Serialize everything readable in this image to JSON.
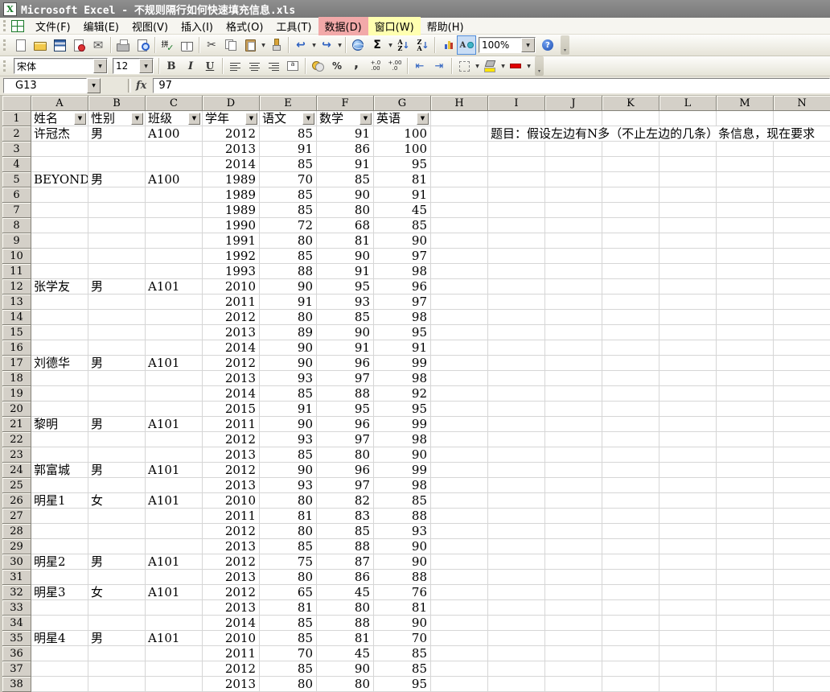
{
  "window_title": "Microsoft Excel - 不规则隔行如何快速填充信息.xls",
  "menu_bar": {
    "items": [
      {
        "name": "menu-item-file",
        "label": "文件(F)"
      },
      {
        "name": "menu-item-edit",
        "label": "编辑(E)"
      },
      {
        "name": "menu-item-view",
        "label": "视图(V)"
      },
      {
        "name": "menu-item-insert",
        "label": "插入(I)"
      },
      {
        "name": "menu-item-format",
        "label": "格式(O)"
      },
      {
        "name": "menu-item-tools",
        "label": "工具(T)"
      },
      {
        "name": "menu-item-data",
        "label": "数据(D)",
        "highlight": "#f2a9a9"
      },
      {
        "name": "menu-item-window",
        "label": "窗口(W)",
        "highlight": "#ffffb0"
      },
      {
        "name": "menu-item-help",
        "label": "帮助(H)"
      }
    ]
  },
  "standard_toolbar": {
    "zoom_value": "100%",
    "icons": [
      {
        "name": "new-icon"
      },
      {
        "name": "open-icon"
      },
      {
        "name": "save-icon"
      },
      {
        "name": "permission-icon"
      },
      {
        "name": "mail-icon",
        "glyph": "✉"
      },
      {
        "name": "separator"
      },
      {
        "name": "print-icon"
      },
      {
        "name": "print-preview-icon"
      },
      {
        "name": "separator"
      },
      {
        "name": "spelling-icon"
      },
      {
        "name": "research-icon"
      },
      {
        "name": "separator"
      },
      {
        "name": "cut-icon",
        "glyph": "✂"
      },
      {
        "name": "copy-icon"
      },
      {
        "name": "paste-icon",
        "dd": true
      },
      {
        "name": "format-painter-icon"
      },
      {
        "name": "separator"
      },
      {
        "name": "undo-icon",
        "glyph": "↩",
        "dd": true
      },
      {
        "name": "redo-icon",
        "glyph": "↪",
        "dd": true
      },
      {
        "name": "separator"
      },
      {
        "name": "hyperlink-icon"
      },
      {
        "name": "autosum-icon",
        "glyph": "Σ",
        "dd": true
      },
      {
        "name": "sort-asc-icon",
        "glyph": "↓"
      },
      {
        "name": "sort-desc-icon",
        "glyph": "↓"
      },
      {
        "name": "separator"
      },
      {
        "name": "chart-wizard-icon"
      },
      {
        "name": "drawing-icon",
        "active": true
      },
      {
        "name": "zoom-combo"
      },
      {
        "name": "help-icon"
      }
    ]
  },
  "formatting_toolbar": {
    "font_name": "宋体",
    "font_size": "12",
    "icons": [
      {
        "name": "font-combo"
      },
      {
        "name": "size-combo"
      },
      {
        "name": "separator"
      },
      {
        "name": "bold-icon",
        "glyph": "B"
      },
      {
        "name": "italic-icon",
        "glyph": "I"
      },
      {
        "name": "underline-icon",
        "glyph": "U"
      },
      {
        "name": "separator"
      },
      {
        "name": "align-left-icon"
      },
      {
        "name": "align-center-icon"
      },
      {
        "name": "align-right-icon"
      },
      {
        "name": "merge-center-icon"
      },
      {
        "name": "separator"
      },
      {
        "name": "currency-icon"
      },
      {
        "name": "percent-icon",
        "glyph": "%"
      },
      {
        "name": "comma-icon",
        "glyph": ","
      },
      {
        "name": "increase-decimal-icon"
      },
      {
        "name": "decrease-decimal-icon"
      },
      {
        "name": "separator"
      },
      {
        "name": "decrease-indent-icon",
        "glyph": "⇤"
      },
      {
        "name": "increase-indent-icon",
        "glyph": "⇥"
      },
      {
        "name": "separator"
      },
      {
        "name": "borders-icon",
        "dd": true
      },
      {
        "name": "fill-color-icon",
        "dd": true
      },
      {
        "name": "font-color-icon",
        "dd": true
      }
    ]
  },
  "formula_bar": {
    "name_box": "G13",
    "fx_label": "fx",
    "formula_value": "97"
  },
  "sheet": {
    "column_letters": [
      "A",
      "B",
      "C",
      "D",
      "E",
      "F",
      "G",
      "H",
      "I",
      "J",
      "K",
      "L",
      "M",
      "N"
    ],
    "filter_headers": [
      "姓名",
      "性别",
      "班级",
      "学年",
      "语文",
      "数学",
      "英语"
    ],
    "note": {
      "cell": "I2",
      "text": "题目：假设左边有N多（不止左边的几条）条信息，现在要求"
    },
    "rows": [
      {
        "n": 2,
        "cells": [
          "许冠杰",
          "男",
          "A100",
          "2012",
          "85",
          "91",
          "100"
        ]
      },
      {
        "n": 3,
        "cells": [
          "",
          "",
          "",
          "2013",
          "91",
          "86",
          "100"
        ]
      },
      {
        "n": 4,
        "cells": [
          "",
          "",
          "",
          "2014",
          "85",
          "91",
          "95"
        ]
      },
      {
        "n": 5,
        "cells": [
          "BEYOND",
          "男",
          "A100",
          "1989",
          "70",
          "85",
          "81"
        ]
      },
      {
        "n": 6,
        "cells": [
          "",
          "",
          "",
          "1989",
          "85",
          "90",
          "91"
        ]
      },
      {
        "n": 7,
        "cells": [
          "",
          "",
          "",
          "1989",
          "85",
          "80",
          "45"
        ]
      },
      {
        "n": 8,
        "cells": [
          "",
          "",
          "",
          "1990",
          "72",
          "68",
          "85"
        ]
      },
      {
        "n": 9,
        "cells": [
          "",
          "",
          "",
          "1991",
          "80",
          "81",
          "90"
        ]
      },
      {
        "n": 10,
        "cells": [
          "",
          "",
          "",
          "1992",
          "85",
          "90",
          "97"
        ]
      },
      {
        "n": 11,
        "cells": [
          "",
          "",
          "",
          "1993",
          "88",
          "91",
          "98"
        ]
      },
      {
        "n": 12,
        "cells": [
          "张学友",
          "男",
          "A101",
          "2010",
          "90",
          "95",
          "96"
        ]
      },
      {
        "n": 13,
        "cells": [
          "",
          "",
          "",
          "2011",
          "91",
          "93",
          "97"
        ]
      },
      {
        "n": 14,
        "cells": [
          "",
          "",
          "",
          "2012",
          "80",
          "85",
          "98"
        ]
      },
      {
        "n": 15,
        "cells": [
          "",
          "",
          "",
          "2013",
          "89",
          "90",
          "95"
        ]
      },
      {
        "n": 16,
        "cells": [
          "",
          "",
          "",
          "2014",
          "90",
          "91",
          "91"
        ]
      },
      {
        "n": 17,
        "cells": [
          "刘德华",
          "男",
          "A101",
          "2012",
          "90",
          "96",
          "99"
        ]
      },
      {
        "n": 18,
        "cells": [
          "",
          "",
          "",
          "2013",
          "93",
          "97",
          "98"
        ]
      },
      {
        "n": 19,
        "cells": [
          "",
          "",
          "",
          "2014",
          "85",
          "88",
          "92"
        ]
      },
      {
        "n": 20,
        "cells": [
          "",
          "",
          "",
          "2015",
          "91",
          "95",
          "95"
        ]
      },
      {
        "n": 21,
        "cells": [
          "黎明",
          "男",
          "A101",
          "2011",
          "90",
          "96",
          "99"
        ]
      },
      {
        "n": 22,
        "cells": [
          "",
          "",
          "",
          "2012",
          "93",
          "97",
          "98"
        ]
      },
      {
        "n": 23,
        "cells": [
          "",
          "",
          "",
          "2013",
          "85",
          "80",
          "90"
        ]
      },
      {
        "n": 24,
        "cells": [
          "郭富城",
          "男",
          "A101",
          "2012",
          "90",
          "96",
          "99"
        ]
      },
      {
        "n": 25,
        "cells": [
          "",
          "",
          "",
          "2013",
          "93",
          "97",
          "98"
        ]
      },
      {
        "n": 26,
        "cells": [
          "明星1",
          "女",
          "A101",
          "2010",
          "80",
          "82",
          "85"
        ]
      },
      {
        "n": 27,
        "cells": [
          "",
          "",
          "",
          "2011",
          "81",
          "83",
          "88"
        ]
      },
      {
        "n": 28,
        "cells": [
          "",
          "",
          "",
          "2012",
          "80",
          "85",
          "93"
        ]
      },
      {
        "n": 29,
        "cells": [
          "",
          "",
          "",
          "2013",
          "85",
          "88",
          "90"
        ]
      },
      {
        "n": 30,
        "cells": [
          "明星2",
          "男",
          "A101",
          "2012",
          "75",
          "87",
          "90"
        ]
      },
      {
        "n": 31,
        "cells": [
          "",
          "",
          "",
          "2013",
          "80",
          "86",
          "88"
        ]
      },
      {
        "n": 32,
        "cells": [
          "明星3",
          "女",
          "A101",
          "2012",
          "65",
          "45",
          "76"
        ]
      },
      {
        "n": 33,
        "cells": [
          "",
          "",
          "",
          "2013",
          "81",
          "80",
          "81"
        ]
      },
      {
        "n": 34,
        "cells": [
          "",
          "",
          "",
          "2014",
          "85",
          "88",
          "90"
        ]
      },
      {
        "n": 35,
        "cells": [
          "明星4",
          "男",
          "A101",
          "2010",
          "85",
          "81",
          "70"
        ]
      },
      {
        "n": 36,
        "cells": [
          "",
          "",
          "",
          "2011",
          "70",
          "45",
          "85"
        ]
      },
      {
        "n": 37,
        "cells": [
          "",
          "",
          "",
          "2012",
          "85",
          "90",
          "85"
        ]
      },
      {
        "n": 38,
        "cells": [
          "",
          "",
          "",
          "2013",
          "80",
          "80",
          "95"
        ]
      }
    ]
  }
}
